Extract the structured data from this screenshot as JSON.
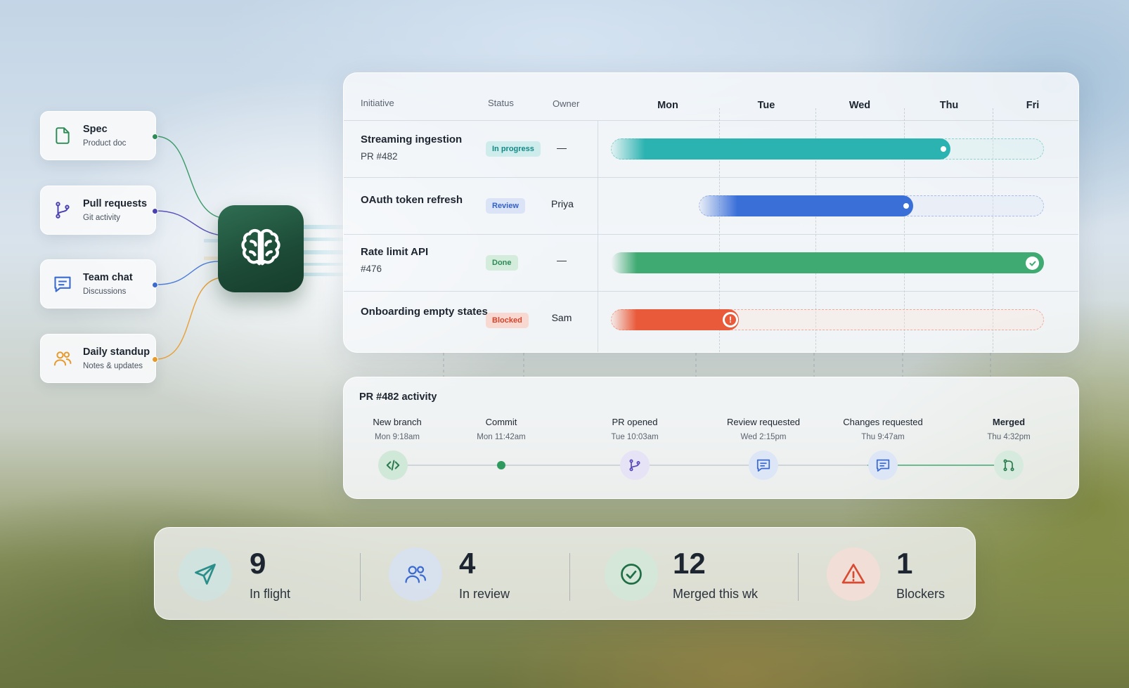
{
  "sources": [
    {
      "title": "Spec",
      "subtitle": "Product doc",
      "icon": "document-icon",
      "color": "#2e8b57"
    },
    {
      "title": "Pull requests",
      "subtitle": "Git activity",
      "icon": "git-branch-icon",
      "color": "#4a40b0"
    },
    {
      "title": "Team chat",
      "subtitle": "Discussions",
      "icon": "chat-icon",
      "color": "#3b6bd0"
    },
    {
      "title": "Daily standup",
      "subtitle": "Notes & updates",
      "icon": "users-icon",
      "color": "#e79a2c"
    }
  ],
  "hub": {
    "icon": "brain-icon"
  },
  "gantt": {
    "headers": {
      "initiative": "Initiative",
      "status": "Status",
      "owner": "Owner"
    },
    "days": [
      "Mon",
      "Tue",
      "Wed",
      "Thu",
      "Fri"
    ],
    "rows": [
      {
        "name": "Streaming ingestion",
        "sub": "PR #482",
        "status": "In progress",
        "owner": "—",
        "progress_end": 0.8,
        "color": "#2bb3b1",
        "state": "progress"
      },
      {
        "name": "OAuth token refresh",
        "sub": "",
        "status": "Review",
        "owner": "Priya",
        "progress_start": 0.22,
        "progress_end": 0.69,
        "color": "#3a6fd8",
        "state": "progress"
      },
      {
        "name": "Rate limit API",
        "sub": "#476",
        "status": "Done",
        "owner": "—",
        "progress_end": 1.0,
        "color": "#3faa72",
        "state": "done"
      },
      {
        "name": "Onboarding empty states",
        "sub": "",
        "status": "Blocked",
        "owner": "Sam",
        "progress_end": 0.29,
        "color": "#e95a3a",
        "state": "blocked"
      }
    ]
  },
  "activity": {
    "title": "PR #482 activity",
    "events": [
      {
        "label": "New branch",
        "time": "Mon 9:18am",
        "icon": "code-icon"
      },
      {
        "label": "Commit",
        "time": "Mon 11:42am",
        "icon": "commit-dot"
      },
      {
        "label": "PR opened",
        "time": "Tue 10:03am",
        "icon": "git-branch-icon"
      },
      {
        "label": "Review requested",
        "time": "Wed 2:15pm",
        "icon": "chat-icon"
      },
      {
        "label": "Changes requested",
        "time": "Thu 9:47am",
        "icon": "chat-icon"
      },
      {
        "label": "Merged",
        "time": "Thu 4:32pm",
        "icon": "git-merge-icon"
      }
    ]
  },
  "stats": [
    {
      "value": "9",
      "label": "In flight",
      "icon": "send-icon"
    },
    {
      "value": "4",
      "label": "In review",
      "icon": "users-icon"
    },
    {
      "value": "12",
      "label": "Merged this wk",
      "icon": "check-circle-icon"
    },
    {
      "value": "1",
      "label": "Blockers",
      "icon": "warning-icon"
    }
  ]
}
